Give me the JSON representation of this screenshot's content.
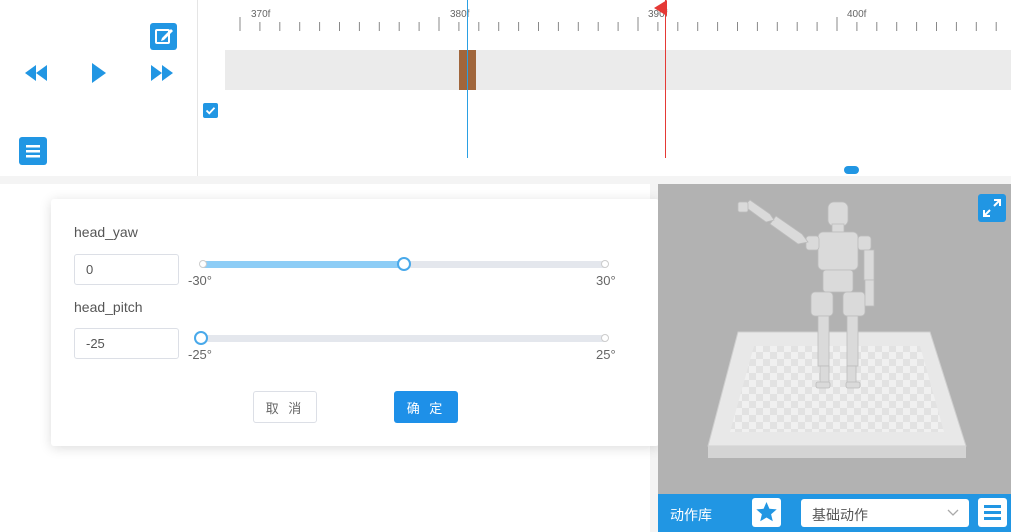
{
  "timeline": {
    "ticks": [
      "370f",
      "380f",
      "390f",
      "400f"
    ]
  },
  "dialog": {
    "params": [
      {
        "name": "head_yaw",
        "value": "0",
        "min": -30,
        "max": 30,
        "min_label": "-30°",
        "max_label": "30°"
      },
      {
        "name": "head_pitch",
        "value": "-25",
        "min": -25,
        "max": 25,
        "min_label": "-25°",
        "max_label": "25°"
      }
    ],
    "cancel_label": "取 消",
    "ok_label": "确 定"
  },
  "bottombar": {
    "library_label": "动作库",
    "category_selected": "基础动作"
  },
  "colors": {
    "accent": "#2196e3",
    "keyframe": "#a0663c",
    "playhead": "#e53935",
    "cursor": "#2aa0e4",
    "slider_fill": "#8dcdf6"
  },
  "icons": [
    "edit-icon",
    "rewind-icon",
    "play-icon",
    "fast-forward-icon",
    "menu-icon",
    "check-icon",
    "expand-icon",
    "star-icon",
    "chevron-down-icon"
  ]
}
